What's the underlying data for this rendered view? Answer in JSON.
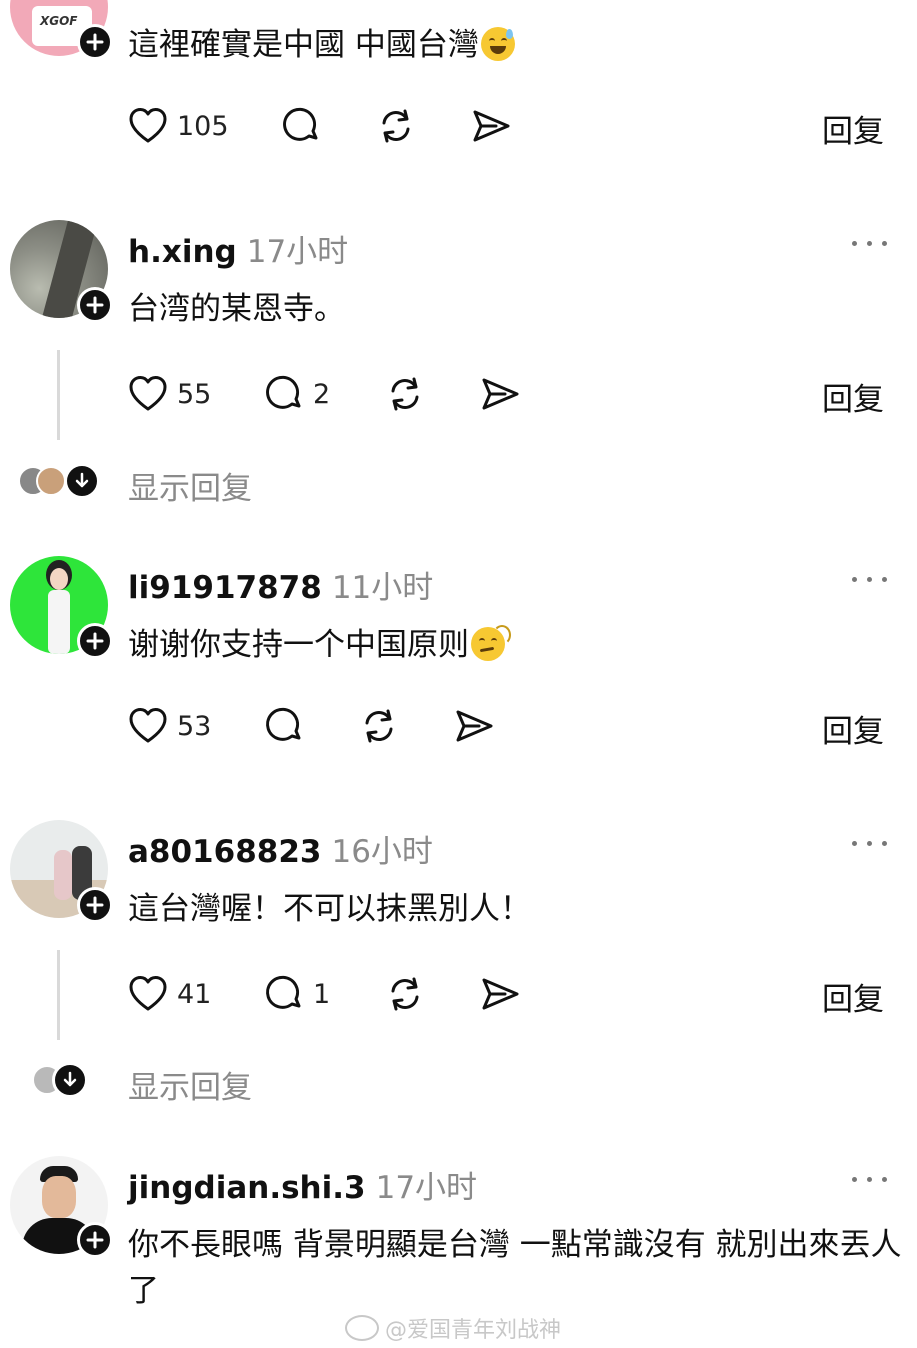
{
  "comments": [
    {
      "username": "",
      "time": "",
      "text": "這裡確實是中國 中國台灣",
      "likes": "105",
      "replies_count": "",
      "reply_label": "回复"
    },
    {
      "username": "h.xing",
      "time": "17小时",
      "text": "台湾的某恩寺。",
      "likes": "55",
      "replies_count": "2",
      "reply_label": "回复",
      "show_replies": "显示回复"
    },
    {
      "username": "li91917878",
      "time": "11小时",
      "text": "谢谢你支持一个中国原则",
      "likes": "53",
      "replies_count": "",
      "reply_label": "回复"
    },
    {
      "username": "a80168823",
      "time": "16小时",
      "text": "這台灣喔！不可以抹黑別人！",
      "likes": "41",
      "replies_count": "1",
      "reply_label": "回复",
      "show_replies": "显示回复"
    },
    {
      "username": "jingdian.shi.3",
      "time": "17小时",
      "text": "你不長眼嗎 背景明顯是台灣 一點常識沒有 就別出來丟人了"
    }
  ],
  "avatar_badge_text": "XGOF",
  "watermark": "@爱国青年刘战神",
  "icons": [
    "heart-icon",
    "comment-icon",
    "repost-icon",
    "share-icon",
    "plus-icon",
    "more-icon",
    "chevron-down-icon"
  ]
}
